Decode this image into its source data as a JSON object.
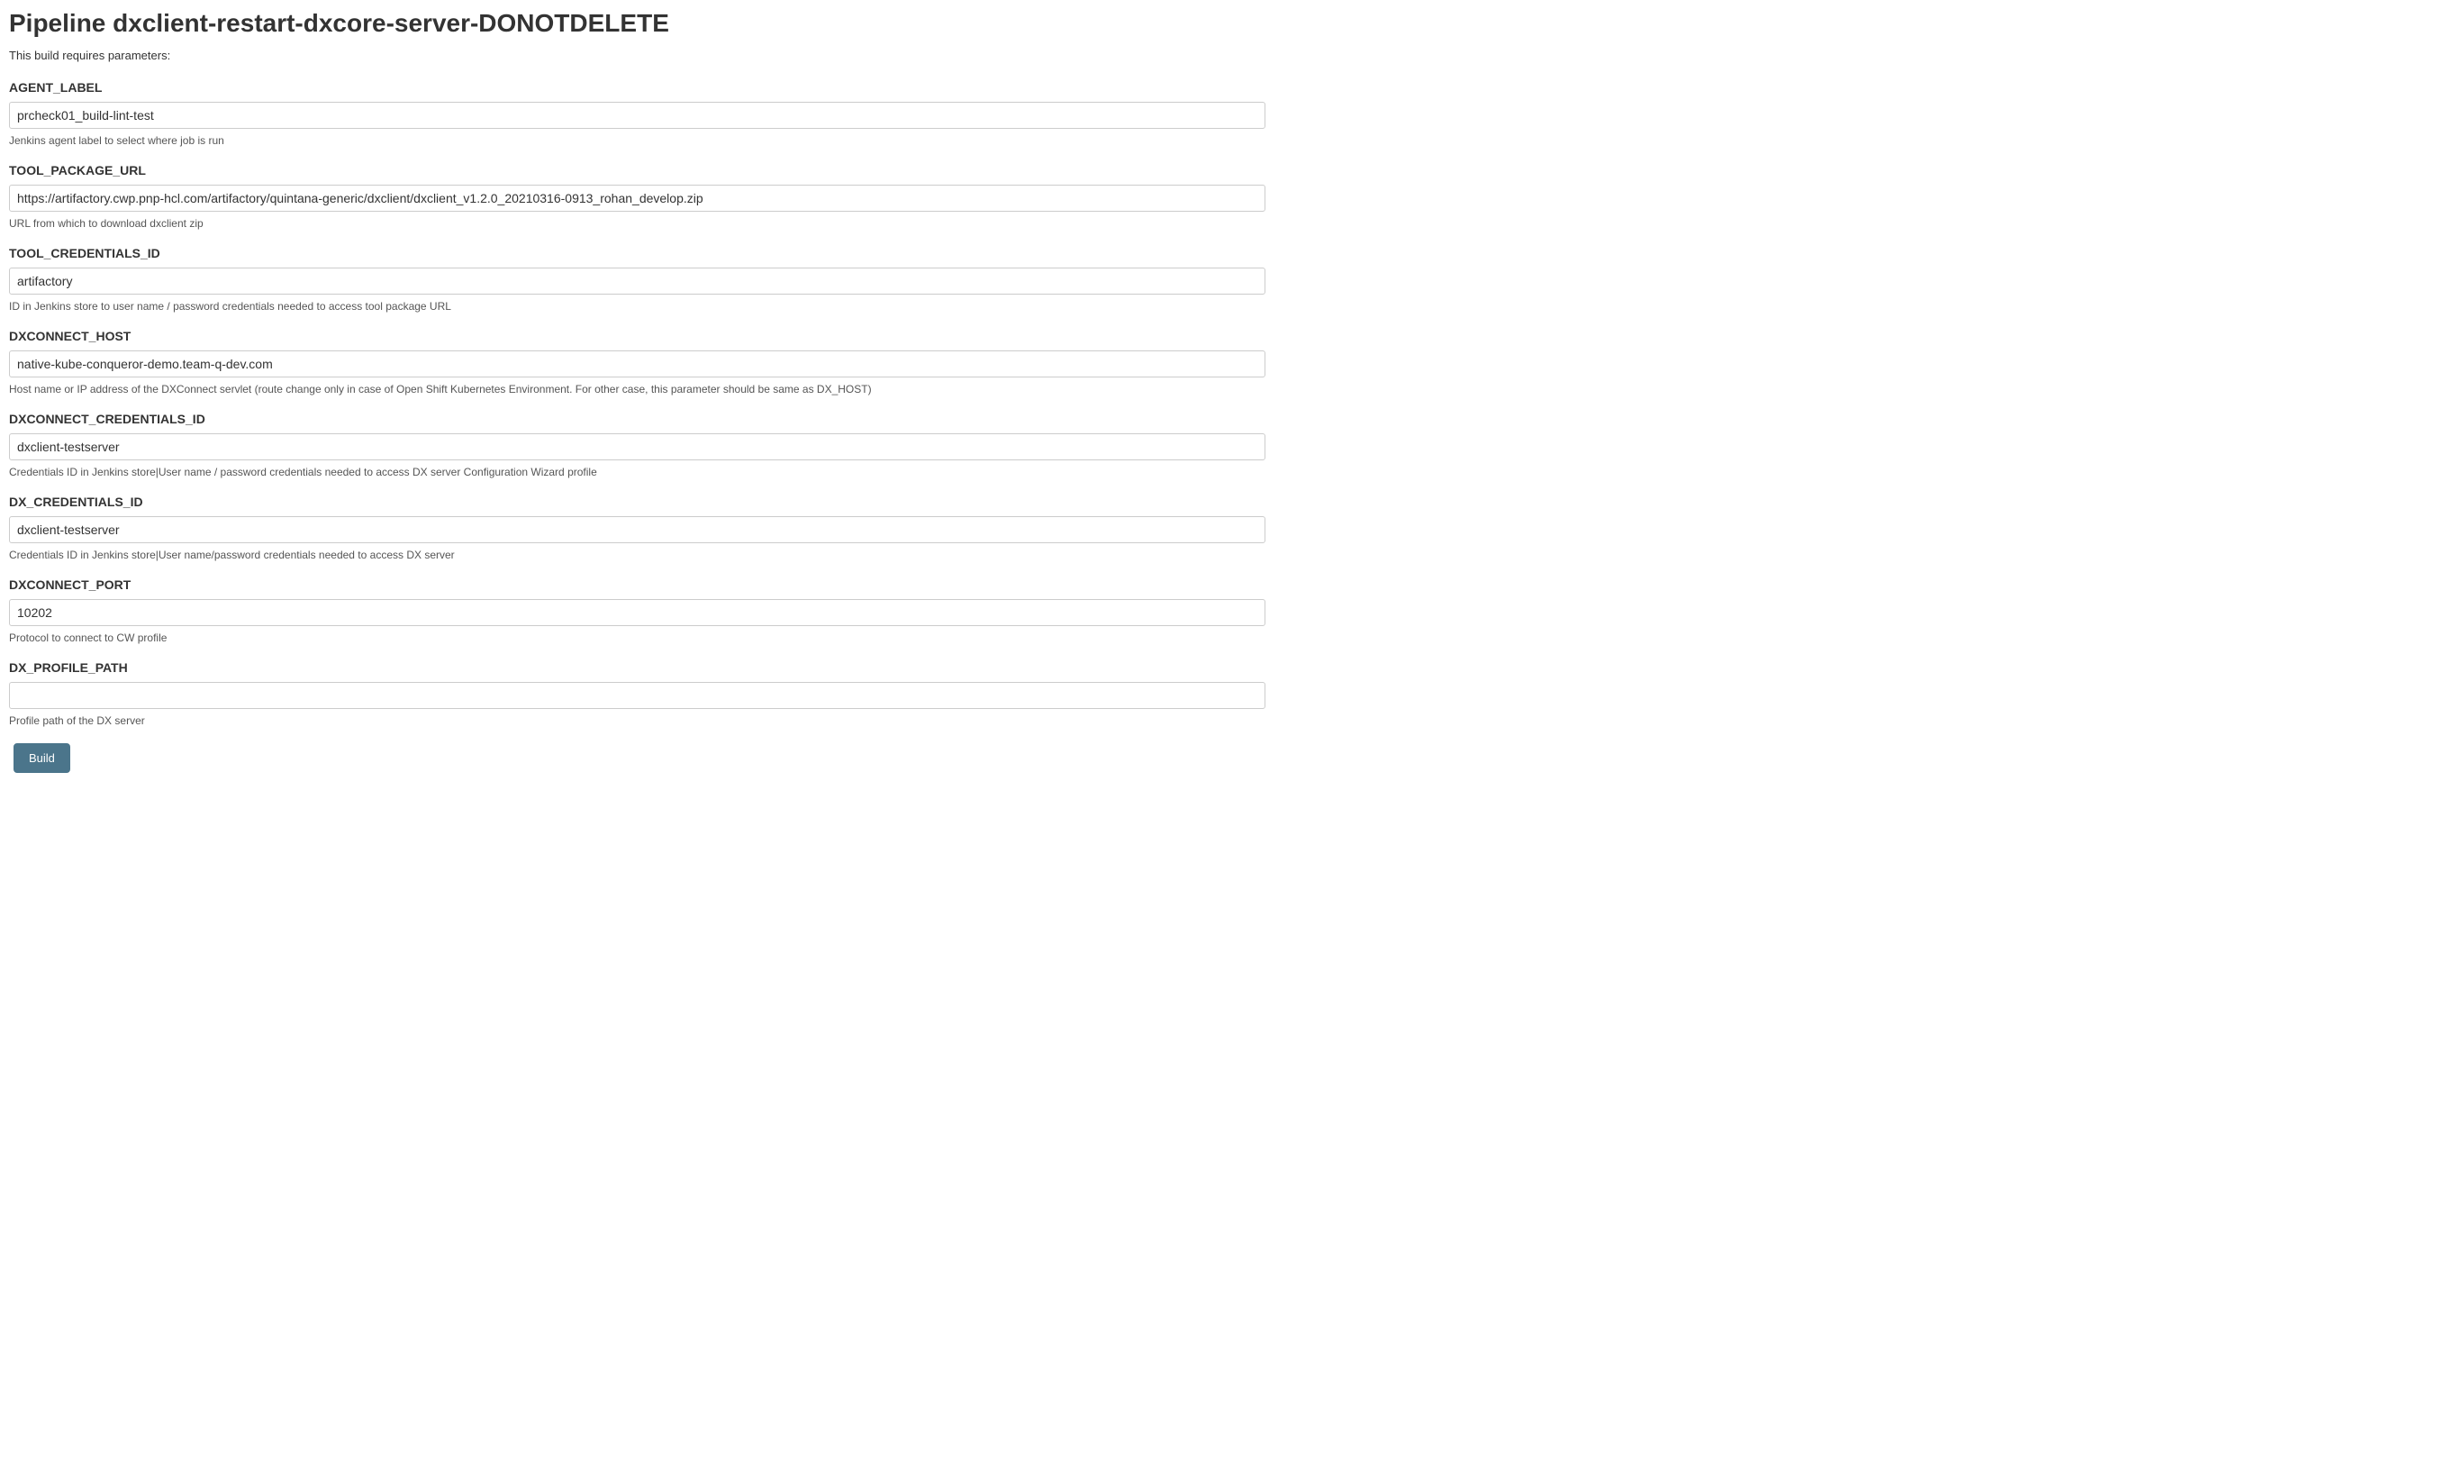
{
  "page_title": "Pipeline dxclient-restart-dxcore-server-DONOTDELETE",
  "build_note": "This build requires parameters:",
  "params": [
    {
      "label": "AGENT_LABEL",
      "value": "prcheck01_build-lint-test",
      "desc": "Jenkins agent label to select where job is run"
    },
    {
      "label": "TOOL_PACKAGE_URL",
      "value": "https://artifactory.cwp.pnp-hcl.com/artifactory/quintana-generic/dxclient/dxclient_v1.2.0_20210316-0913_rohan_develop.zip",
      "desc": "URL from which to download dxclient zip"
    },
    {
      "label": "TOOL_CREDENTIALS_ID",
      "value": "artifactory",
      "desc": "ID in Jenkins store to user name / password credentials needed to access tool package URL"
    },
    {
      "label": "DXCONNECT_HOST",
      "value": "native-kube-conqueror-demo.team-q-dev.com",
      "desc": "Host name or IP address of the DXConnect servlet (route change only in case of Open Shift Kubernetes Environment. For other case, this parameter should be same as DX_HOST)"
    },
    {
      "label": "DXCONNECT_CREDENTIALS_ID",
      "value": "dxclient-testserver",
      "desc": "Credentials ID in Jenkins store|User name / password credentials needed to access DX server Configuration Wizard profile"
    },
    {
      "label": "DX_CREDENTIALS_ID",
      "value": "dxclient-testserver",
      "desc": "Credentials ID in Jenkins store|User name/password credentials needed to access DX server"
    },
    {
      "label": "DXCONNECT_PORT",
      "value": "10202",
      "desc": "Protocol to connect to CW profile"
    },
    {
      "label": "DX_PROFILE_PATH",
      "value": "",
      "desc": "Profile path of the DX server"
    }
  ],
  "build_button_label": "Build"
}
